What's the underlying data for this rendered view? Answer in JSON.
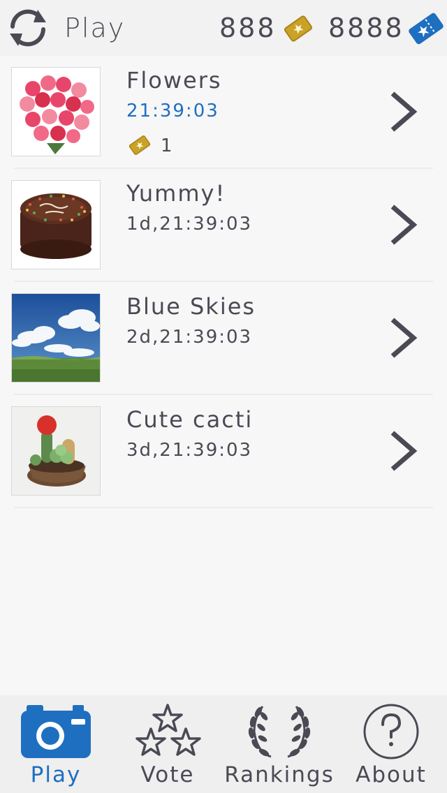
{
  "header": {
    "title": "Play",
    "coins": "888",
    "tickets": "8888",
    "refresh_icon": "refresh-icon",
    "coin_icon": "gold-ticket-icon",
    "ticket_icon": "blue-ticket-icon"
  },
  "games": [
    {
      "title": "Flowers",
      "time": "21:39:03",
      "active": true,
      "reward": "1",
      "image": "roses-bouquet"
    },
    {
      "title": "Yummy!",
      "time": "1d,21:39:03",
      "active": false,
      "image": "chocolate-cake"
    },
    {
      "title": "Blue Skies",
      "time": "2d,21:39:03",
      "active": false,
      "image": "sky-landscape"
    },
    {
      "title": "Cute cacti",
      "time": "3d,21:39:03",
      "active": false,
      "image": "crochet-cacti"
    }
  ],
  "tabs": [
    {
      "label": "Play",
      "icon": "camera-icon",
      "active": true
    },
    {
      "label": "Vote",
      "icon": "stars-icon",
      "active": false
    },
    {
      "label": "Rankings",
      "icon": "laurel-icon",
      "active": false
    },
    {
      "label": "About",
      "icon": "question-icon",
      "active": false
    }
  ],
  "colors": {
    "accent": "#1e6fc0",
    "text": "#4a4a55",
    "gold": "#c9a227"
  }
}
